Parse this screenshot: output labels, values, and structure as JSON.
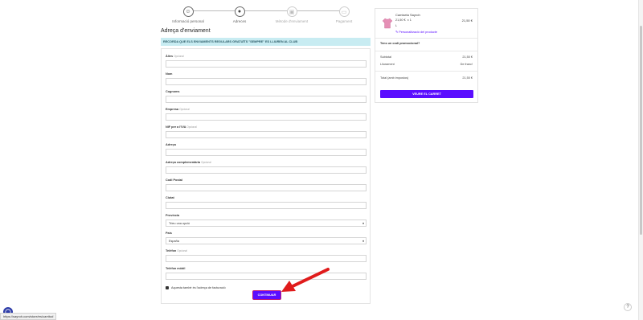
{
  "steps": [
    {
      "label": "Informació personal",
      "state": "done",
      "icon": "user-icon"
    },
    {
      "label": "Adreces",
      "state": "done",
      "icon": "location-pin-icon"
    },
    {
      "label": "Mètode d'enviament",
      "state": "todo",
      "icon": "truck-icon"
    },
    {
      "label": "Pagament",
      "state": "todo",
      "icon": "card-icon"
    }
  ],
  "address": {
    "title": "Adreça d'enviament",
    "notice": "RECORDA QUE ELS ENVIAMENTS REGULARS GRATUÏTS \"SEMPRE\" ES LLIUREN AL CLUB",
    "optional": "Opcional",
    "fields": {
      "alias": "Àlies",
      "first_name": "Nom",
      "last_name": "Cognoms",
      "company": "Empresa",
      "vat": "NIF per a l'IVA",
      "address": "Adreça",
      "address2": "Adreça complementària",
      "postcode": "Codi Postal",
      "city": "Ciutat",
      "province": "Província",
      "province_value": "Trieu una opció",
      "country": "País",
      "country_value": "España",
      "phone": "Telèfon",
      "mobile": "Telèfon mòbil"
    },
    "billing_checkbox": "Aquesta també és l'adreça de facturació",
    "continue_label": "CONTINUAR"
  },
  "cart": {
    "product_name": "Camiseta Sayroh",
    "unit_price": "21,50 €",
    "qty": "x 1",
    "size": "L",
    "line_total": "21,50 €",
    "customize": "Personalització del producte",
    "promo": "Tens un codi promocional?",
    "subtotal_label": "Subtotal",
    "subtotal_value": "21,50 €",
    "shipping_label": "Lliurament",
    "shipping_value": "De franc!",
    "total_label": "Total (amb impostos)",
    "total_value": "21,50 €",
    "view_cart": "VEURE EL CARRET"
  },
  "status_url": "https://sayroh.com/store/es/carrito#",
  "colors": {
    "primary": "#5b0dff",
    "arrow": "#e01b1b",
    "notice_bg": "#c8ecf2"
  }
}
